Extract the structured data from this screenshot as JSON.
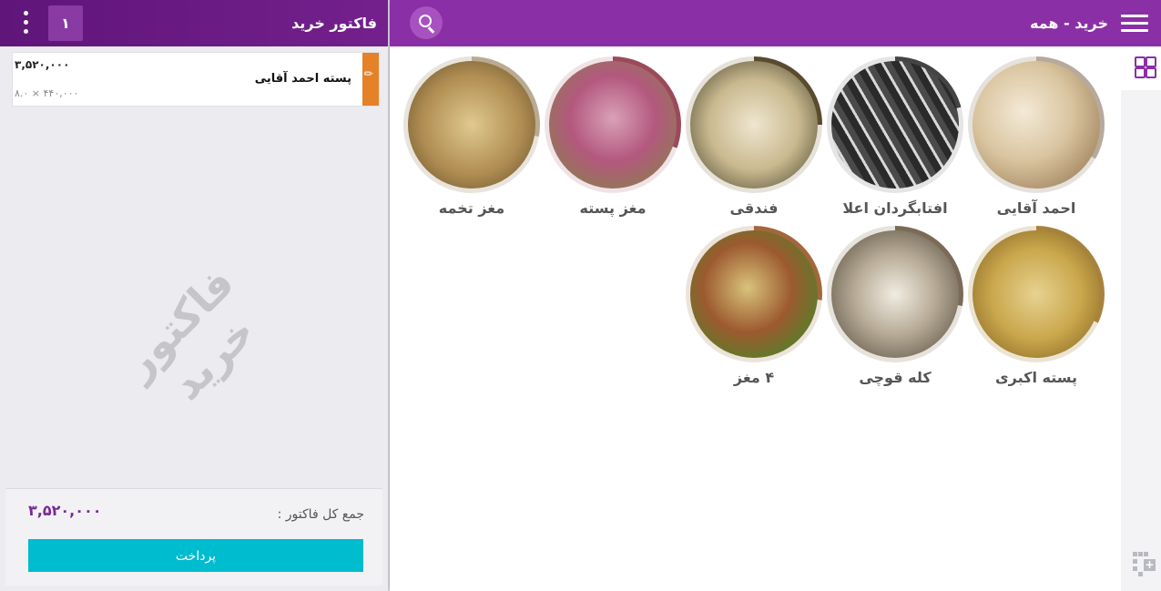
{
  "invoice": {
    "title": "فاکتور خرید",
    "item_count": "۱",
    "watermark": "فاکتور خرید",
    "lines": [
      {
        "name": "پسته احمد آقایی",
        "total": "۳,۵۲۰,۰۰۰",
        "calc": "۸.۰ × ۴۴۰,۰۰۰"
      }
    ],
    "total_label": "جمع کل فاکتور :",
    "total_value": "۳,۵۲۰,۰۰۰",
    "pay_label": "پرداخت"
  },
  "catalog": {
    "title": "خرید - همه",
    "products": [
      {
        "name": "احمد آقایی"
      },
      {
        "name": "افتابگردان اعلا"
      },
      {
        "name": "فندقی"
      },
      {
        "name": "مغز پسته"
      },
      {
        "name": "مغز تخمه"
      },
      {
        "name": "پسته اکبری"
      },
      {
        "name": "کله قوچی"
      },
      {
        "name": "۴ مغز"
      }
    ]
  },
  "colors": {
    "header_purple": "#8b2fa6",
    "invoice_header": "#6a1b84",
    "pay_button": "#00bccf",
    "line_accent": "#e58126",
    "total_value": "#7a2a93"
  },
  "icons": [
    "menu-icon",
    "search-icon",
    "kebab-menu-icon",
    "grid-view-icon",
    "add-grid-icon",
    "edit-pencil-icon"
  ]
}
